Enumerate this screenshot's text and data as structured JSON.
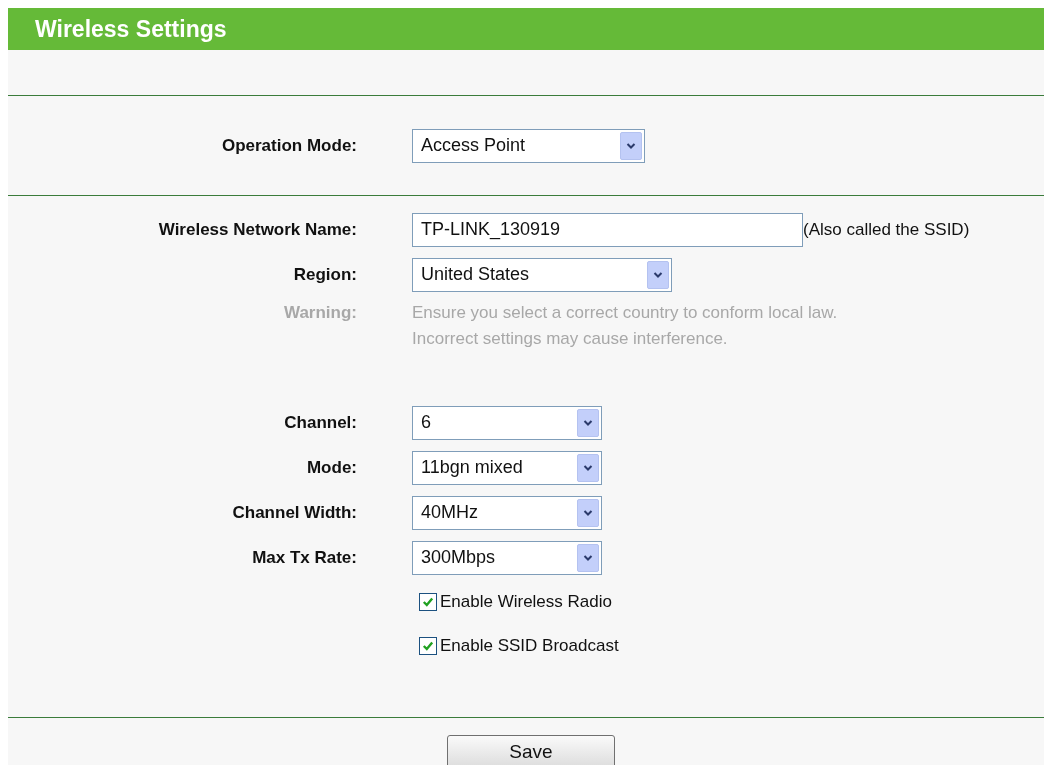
{
  "title": "Wireless Settings",
  "operation_mode": {
    "label": "Operation Mode:",
    "value": "Access Point"
  },
  "groups": [
    [
      {
        "kind": "text",
        "label": "Wireless Network Name:",
        "value": "TP-LINK_130919",
        "hint": "(Also called the SSID)"
      },
      {
        "kind": "select",
        "label": "Region:",
        "value": "United States"
      },
      {
        "kind": "note",
        "label": "Warning:",
        "lines": [
          "Ensure you select a correct country to conform local law.",
          "Incorrect settings may cause interference."
        ]
      }
    ],
    [
      {
        "kind": "select",
        "label": "Channel:",
        "value": "6"
      },
      {
        "kind": "select",
        "label": "Mode:",
        "value": "11bgn mixed"
      },
      {
        "kind": "select",
        "label": "Channel Width:",
        "value": "40MHz"
      },
      {
        "kind": "select",
        "label": "Max Tx Rate:",
        "value": "300Mbps"
      },
      {
        "kind": "checkbox",
        "label": "Enable Wireless Radio",
        "checked": true
      },
      {
        "kind": "checkbox",
        "label": "Enable SSID Broadcast",
        "checked": true
      }
    ]
  ],
  "save_button": "Save"
}
